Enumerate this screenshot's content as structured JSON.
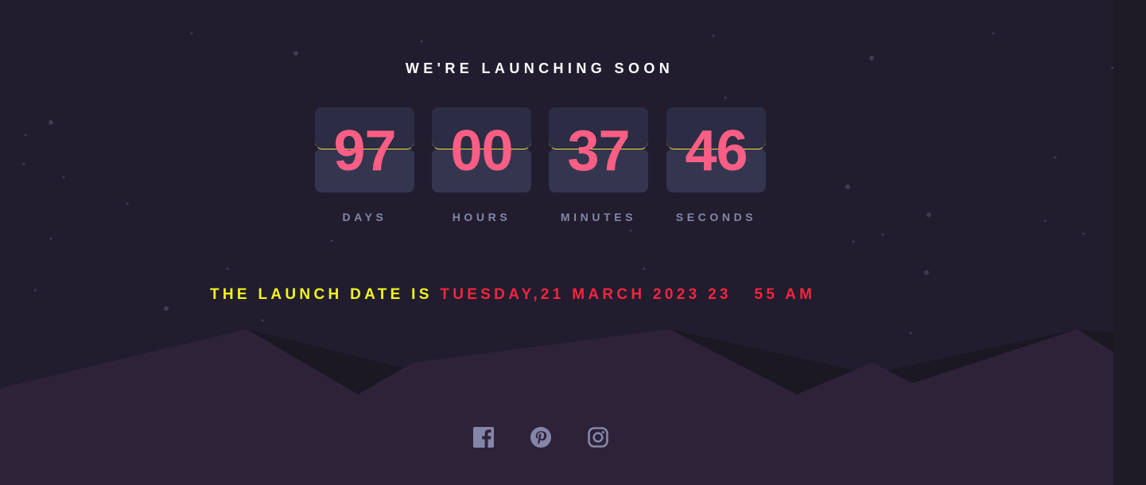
{
  "headline": "WE'RE LAUNCHING SOON",
  "countdown": {
    "days": "97",
    "hours": "00",
    "minutes": "37",
    "seconds": "46",
    "labels": {
      "days": "DAYS",
      "hours": "HOURS",
      "minutes": "MINUTES",
      "seconds": "SECONDS"
    }
  },
  "launch": {
    "prefix": "THE LAUNCH DATE IS ",
    "date": "TUESDAY,21 MARCH 2023 23   55 AM"
  },
  "social": [
    {
      "icon": "facebook-icon"
    },
    {
      "icon": "pinterest-icon"
    },
    {
      "icon": "instagram-icon"
    }
  ],
  "colors": {
    "background": "#211d2f",
    "hills_back": "#1b1824",
    "hills_front": "#2e2239",
    "tile": "#343650",
    "digits": "#fb5e84",
    "label": "#8486a9",
    "launch_prefix": "#f4f51c",
    "launch_date": "#f5243e",
    "icon": "#8486a9"
  }
}
